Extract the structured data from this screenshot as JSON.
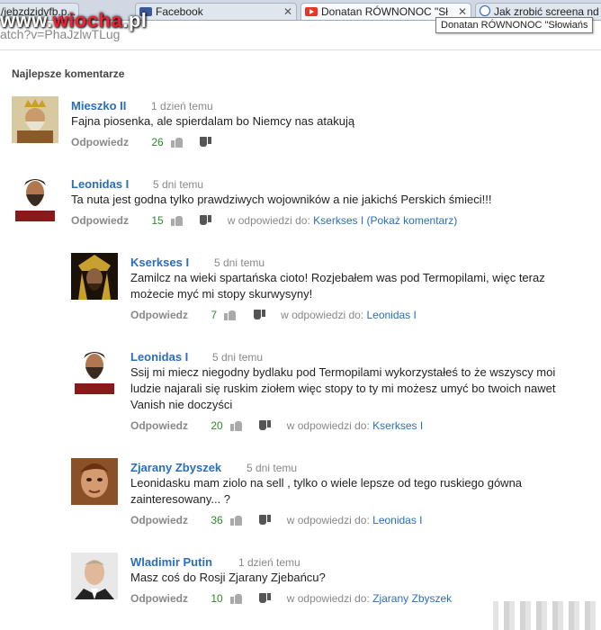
{
  "browser": {
    "tabs": [
      {
        "label": "/jebzdzidyfb.p...",
        "icon": "page-icon"
      },
      {
        "label": "Facebook",
        "icon": "facebook-icon"
      },
      {
        "label": "Donatan RÓWNONOC \"Sł",
        "icon": "youtube-icon"
      },
      {
        "label": "Jak zrobić screena nd",
        "icon": "help-icon"
      }
    ],
    "address": "atch?v=PhaJzlwTLug",
    "tooltip": "Donatan RÓWNONOC \"Słowiańs"
  },
  "watermark": {
    "prefix": "www.",
    "brand": "wiocha",
    "suffix": ".pl"
  },
  "section_title": "Najlepsze komentarze",
  "labels": {
    "reply": "Odpowiedz",
    "in_reply": "w odpowiedzi do:"
  },
  "comments": [
    {
      "author": "Mieszko II",
      "time": "1 dzień temu",
      "lines": [
        "Fajna piosenka, ale spierdalam bo Niemcy nas atakują"
      ],
      "likes": "26",
      "in_reply_to": ""
    },
    {
      "author": "Leonidas I",
      "time": "5 dni temu",
      "lines": [
        "Ta nuta jest godna tylko prawdziwych wojowników a nie jakichś Perskich śmieci!!!"
      ],
      "likes": "15",
      "in_reply_to": "Kserkses I (Pokaż komentarz)"
    },
    {
      "author": "Kserkses I",
      "time": "5 dni temu",
      "lines": [
        "Zamilcz na wieki spartańska cioto! Rozjebałem was pod Termopilami, więc teraz",
        "możecie myć mi stopy skurwysyny!"
      ],
      "likes": "7",
      "in_reply_to": "Leonidas I"
    },
    {
      "author": "Leonidas I",
      "time": "5 dni temu",
      "lines": [
        "Ssij mi miecz niegodny bydlaku pod Termopilami wykorzystałeś to że wszyscy moi",
        "ludzie najarali się ruskim ziołem więc stopy to ty mi możesz umyć bo twoich nawet",
        "Vanish nie doczyści"
      ],
      "likes": "20",
      "in_reply_to": "Kserkses I"
    },
    {
      "author": "Zjarany Zbyszek",
      "time": "5 dni temu",
      "lines": [
        "Leonidasku mam ziolo na sell , tylko o wiele lepsze od tego ruskiego gówna",
        "zainteresowany... ?"
      ],
      "likes": "36",
      "in_reply_to": "Leonidas I"
    },
    {
      "author": "Wladimir Putin",
      "time": "1 dzień temu",
      "lines": [
        "Masz coś do Rosji Zjarany Zjebańcu?"
      ],
      "likes": "10",
      "in_reply_to": "Zjarany Zbyszek"
    }
  ],
  "colors": {
    "author": "#2a6ebb",
    "likes": "#2b8a2b",
    "meta": "#888888"
  }
}
